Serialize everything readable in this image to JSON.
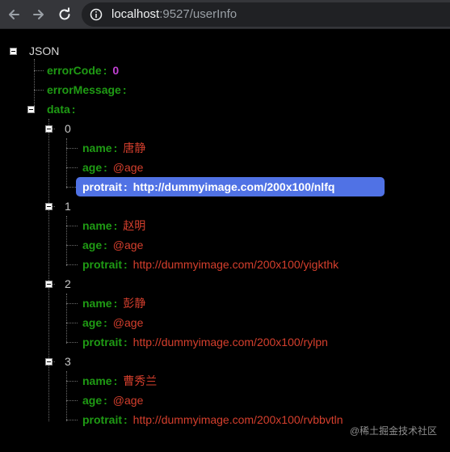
{
  "browser": {
    "url_host": "localhost",
    "url_path": ":9527/userInfo",
    "icons": [
      "back-arrow-icon",
      "forward-arrow-icon",
      "reload-icon",
      "info-icon"
    ]
  },
  "json_viewer": {
    "root_label": "JSON",
    "error_code_key": "errorCode",
    "error_code_value": "0",
    "error_message_key": "errorMessage",
    "data_key": "data",
    "separator": ":",
    "items": [
      {
        "index": "0",
        "name_key": "name",
        "name": "唐静",
        "age_key": "age",
        "age": "@age",
        "protrait_key": "protrait",
        "protrait": "http://dummyimage.com/200x100/nlfq"
      },
      {
        "index": "1",
        "name_key": "name",
        "name": "赵明",
        "age_key": "age",
        "age": "@age",
        "protrait_key": "protrait",
        "protrait": "http://dummyimage.com/200x100/yigkthk"
      },
      {
        "index": "2",
        "name_key": "name",
        "name": "彭静",
        "age_key": "age",
        "age": "@age",
        "protrait_key": "protrait",
        "protrait": "http://dummyimage.com/200x100/rylpn"
      },
      {
        "index": "3",
        "name_key": "name",
        "name": "曹秀兰",
        "age_key": "age",
        "age": "@age",
        "protrait_key": "protrait",
        "protrait": "http://dummyimage.com/200x100/rvbbvtln"
      }
    ]
  },
  "colors": {
    "key_green": "#1f9b14",
    "string_red": "#d53f2d",
    "number_purple": "#c242d4",
    "selection_blue": "#5072e5",
    "background": "#000000"
  },
  "watermark": "@稀土掘金技术社区"
}
